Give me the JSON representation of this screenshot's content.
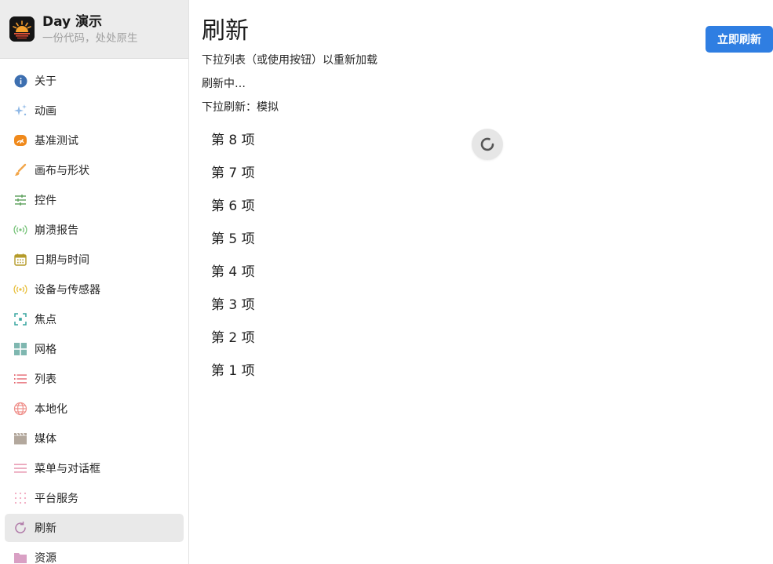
{
  "brand": {
    "title": "Day 演示",
    "subtitle": "一份代码，处处原生"
  },
  "sidebar": {
    "items": [
      {
        "label": "关于",
        "icon": "info-icon",
        "color": "#3d6fb0"
      },
      {
        "label": "动画",
        "icon": "sparkle-icon",
        "color": "#8fb8e6"
      },
      {
        "label": "基准测试",
        "icon": "speedometer-icon",
        "color": "#f08a1c"
      },
      {
        "label": "画布与形状",
        "icon": "brush-icon",
        "color": "#f2a64a"
      },
      {
        "label": "控件",
        "icon": "sliders-icon",
        "color": "#5aa05a"
      },
      {
        "label": "崩溃报告",
        "icon": "broadcast-icon",
        "color": "#79c47b"
      },
      {
        "label": "日期与时间",
        "icon": "calendar-icon",
        "color": "#b59b2a"
      },
      {
        "label": "设备与传感器",
        "icon": "sensor-icon",
        "color": "#e8c040"
      },
      {
        "label": "焦点",
        "icon": "focus-icon",
        "color": "#3aa6a0"
      },
      {
        "label": "网格",
        "icon": "grid-icon",
        "color": "#7fb7b0"
      },
      {
        "label": "列表",
        "icon": "list-icon",
        "color": "#e0505a"
      },
      {
        "label": "本地化",
        "icon": "globe-icon",
        "color": "#ef8f8a"
      },
      {
        "label": "媒体",
        "icon": "clapperboard-icon",
        "color": "#b3a89d"
      },
      {
        "label": "菜单与对话框",
        "icon": "menu-icon",
        "color": "#e07a9a"
      },
      {
        "label": "平台服务",
        "icon": "dots-grid-icon",
        "color": "#f0a9c0"
      },
      {
        "label": "刷新",
        "icon": "refresh-icon",
        "color": "#b07aa8",
        "active": true
      },
      {
        "label": "资源",
        "icon": "folder-icon",
        "color": "#d9a0c4"
      }
    ]
  },
  "main": {
    "title": "刷新",
    "refresh_button": "立即刷新",
    "description": "下拉列表（或使用按钮）以重新加载",
    "status": "刷新中…",
    "mode": "下拉刷新：模拟",
    "items": [
      "第 8 项",
      "第 7 项",
      "第 6 项",
      "第 5 项",
      "第 4 项",
      "第 3 项",
      "第 2 项",
      "第 1 项"
    ]
  },
  "colors": {
    "accent": "#2f7ee2",
    "sidebar_header_bg": "#ececec",
    "active_item_bg": "#e9e9e9"
  }
}
